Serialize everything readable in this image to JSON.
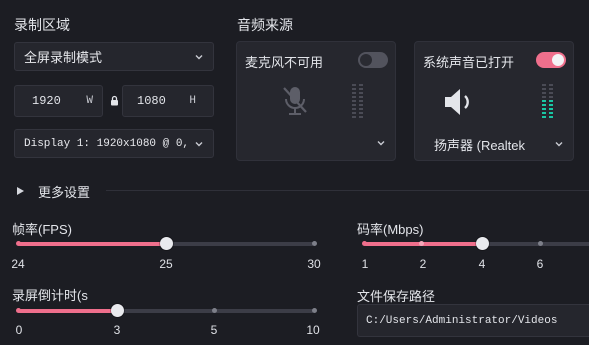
{
  "recording_area": {
    "title": "录制区域",
    "mode_value": "全屏录制模式",
    "width_value": "1920",
    "width_unit": "W",
    "height_value": "1080",
    "height_unit": "H",
    "display_value": "Display 1: 1920x1080 @ 0,"
  },
  "audio_source": {
    "title": "音频来源",
    "microphone": {
      "label": "麦克风不可用",
      "enabled": false,
      "device_value": ""
    },
    "system_audio": {
      "label": "系统声音已打开",
      "enabled": true,
      "device_value": "扬声器 (Realtek"
    }
  },
  "more_settings": {
    "label": "更多设置"
  },
  "frame_rate": {
    "label": "帧率(FPS)",
    "ticks": [
      "24",
      "25",
      "30"
    ],
    "value_fraction": 0.5
  },
  "bitrate": {
    "label": "码率(Mbps)",
    "ticks": [
      "1",
      "2",
      "4",
      "6"
    ],
    "value_fraction": 0.5
  },
  "countdown": {
    "label": "录屏倒计时(s",
    "ticks": [
      "0",
      "3",
      "5",
      "10"
    ],
    "value_fraction": 0.333
  },
  "save_path": {
    "label": "文件保存路径",
    "value": "C:/Users/Administrator/Videos"
  },
  "colors": {
    "accent": "#ef6f8c",
    "background": "#1c1d23",
    "panel": "#26272e"
  }
}
